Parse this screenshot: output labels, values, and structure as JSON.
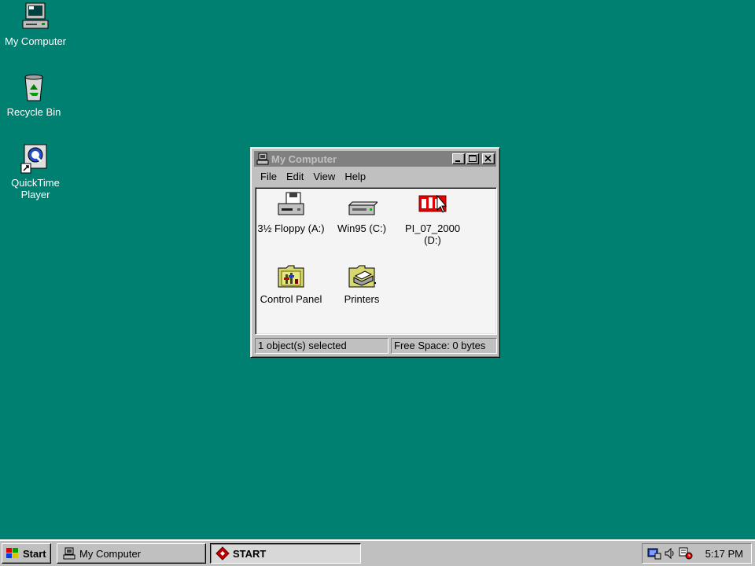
{
  "desktop": {
    "background": "#008070",
    "icons": [
      {
        "label": "My Computer"
      },
      {
        "label": "Recycle Bin"
      },
      {
        "label": "QuickTime Player"
      }
    ]
  },
  "window": {
    "title": "My Computer",
    "menu": [
      "File",
      "Edit",
      "View",
      "Help"
    ],
    "items": [
      {
        "label": "3½ Floppy (A:)",
        "icon": "floppy-drive-icon"
      },
      {
        "label": "Win95 (C:)",
        "icon": "hard-drive-icon"
      },
      {
        "label": "PI_07_2000 (D:)",
        "icon": "cd-drive-icon"
      },
      {
        "label": "Control Panel",
        "icon": "control-panel-folder-icon"
      },
      {
        "label": "Printers",
        "icon": "printers-folder-icon"
      }
    ],
    "status_left": "1 object(s) selected",
    "status_right": "Free Space: 0 bytes"
  },
  "taskbar": {
    "start_label": "Start",
    "tasks": [
      {
        "label": "My Computer"
      },
      {
        "label": "START"
      }
    ],
    "clock": "5:17 PM"
  }
}
